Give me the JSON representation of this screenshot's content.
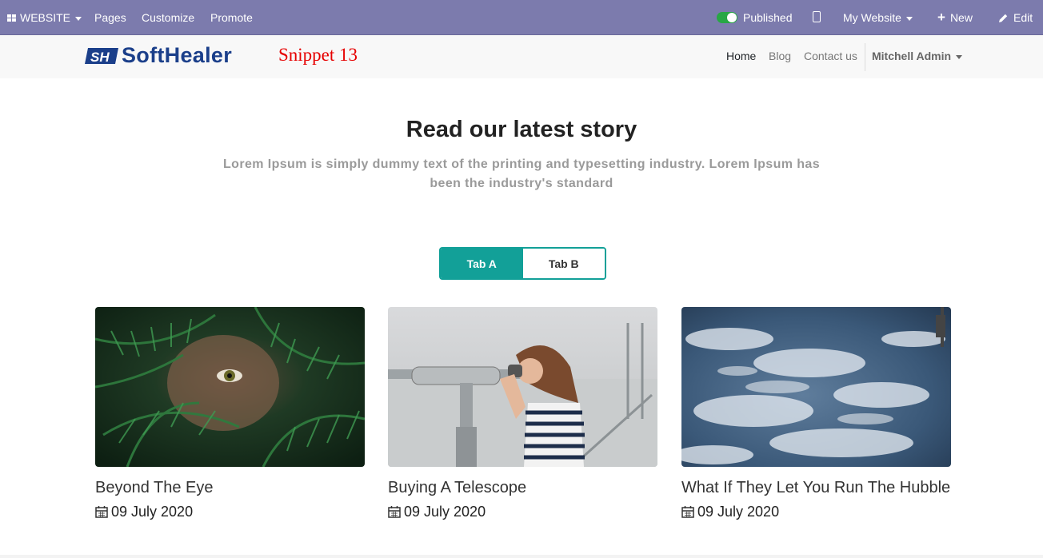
{
  "adminbar": {
    "website_menu": "WEBSITE",
    "pages": "Pages",
    "customize": "Customize",
    "promote": "Promote",
    "published": "Published",
    "my_website": "My Website",
    "new": "New",
    "edit": "Edit"
  },
  "navbar": {
    "logo_text": "SoftHealer",
    "snippet_title": "Snippet 13",
    "links": [
      "Home",
      "Blog",
      "Contact us"
    ],
    "user": "Mitchell Admin"
  },
  "section": {
    "heading": "Read our latest story",
    "subheading": "Lorem Ipsum is simply dummy text of the printing and typesetting industry. Lorem Ipsum has been the industry's standard",
    "tabs": [
      "Tab A",
      "Tab B"
    ]
  },
  "cards": [
    {
      "title": "Beyond The Eye",
      "date": "09 July 2020",
      "image": "fern-eye-photo"
    },
    {
      "title": "Buying A Telescope",
      "date": "09 July 2020",
      "image": "woman-binocular-photo"
    },
    {
      "title": "What If They Let You Run The Hubble",
      "date": "09 July 2020",
      "image": "earth-from-space-photo"
    }
  ],
  "colors": {
    "adminbar": "#7c7bad",
    "accent": "#12a098",
    "snippet_title": "#e60000",
    "logo": "#1b3f8a"
  }
}
